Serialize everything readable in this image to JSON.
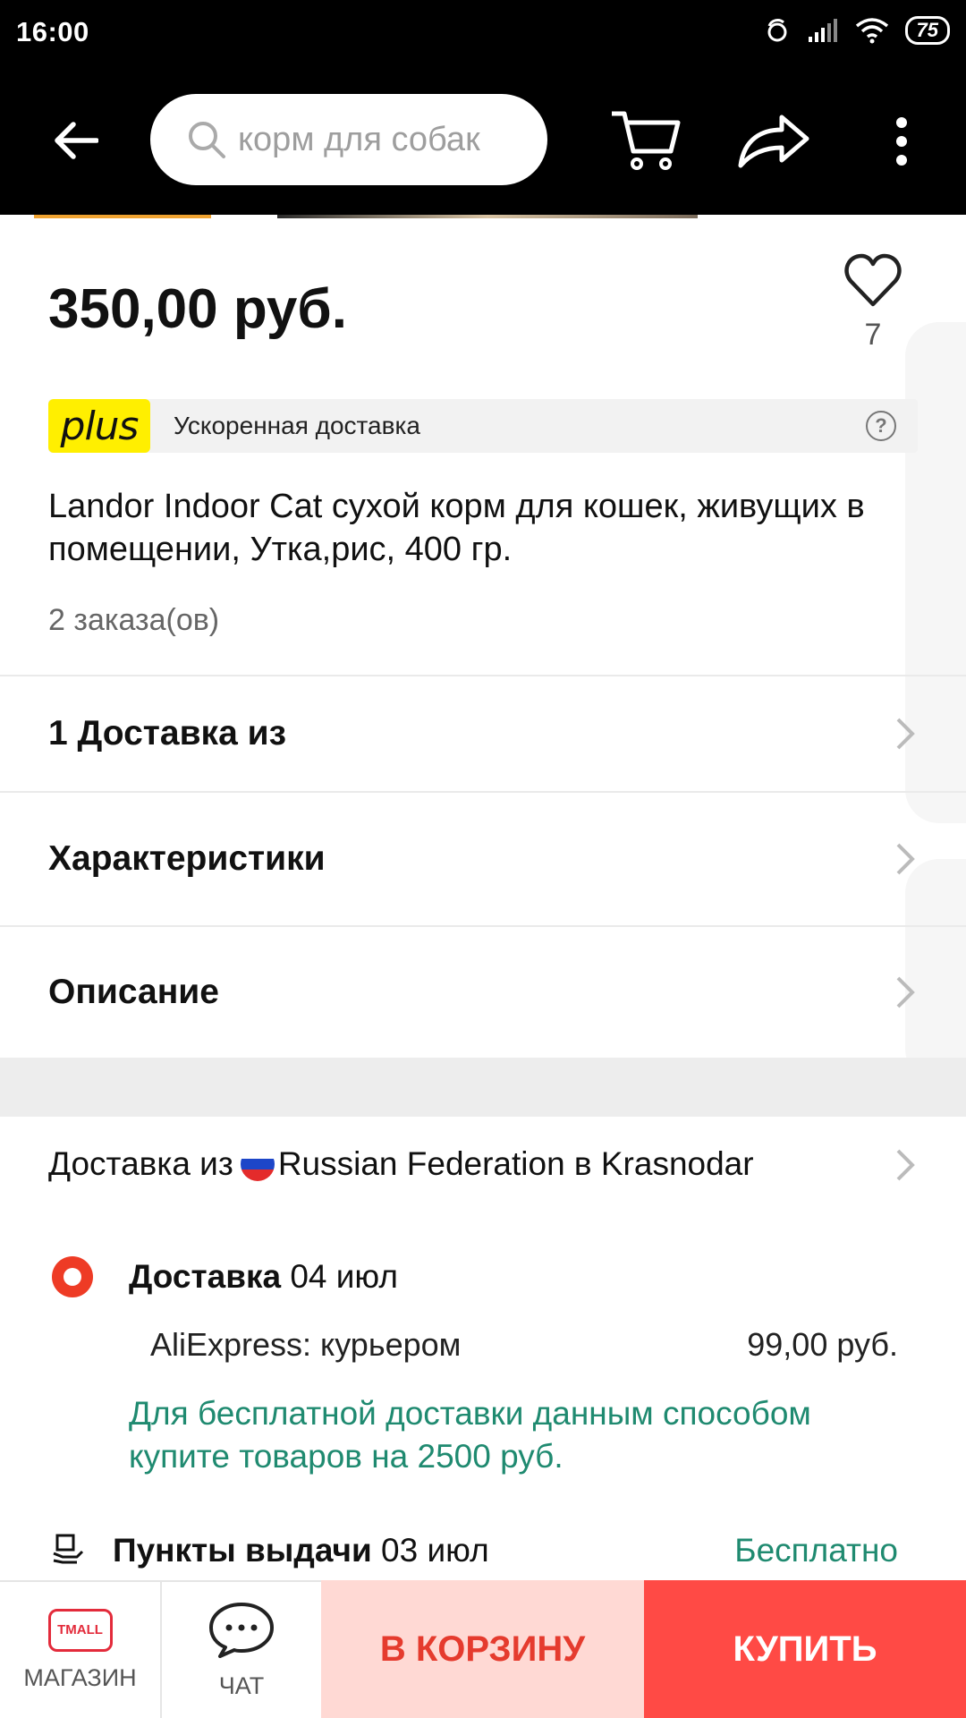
{
  "status_bar": {
    "time": "16:00",
    "battery": "75"
  },
  "header": {
    "search_placeholder": "корм для собак"
  },
  "product": {
    "price": "350,00 руб.",
    "wishlist_count": "7",
    "plus_logo": "plus",
    "plus_text": "Ускоренная доставка",
    "title": "Landor Indoor Cat сухой корм для кошек, живущих в помещении, Утка,рис, 400 гр.",
    "orders": "2 заказа(ов)"
  },
  "sections": {
    "delivery_from": "1 Доставка из",
    "specs": "Характеристики",
    "description": "Описание"
  },
  "shipping": {
    "from_prefix": "Доставка из",
    "from_country": "Russian Federation в Krasnodar",
    "option_label": "Доставка",
    "option_date": "04 июл",
    "carrier": "AliExpress: курьером",
    "carrier_price": "99,00 руб.",
    "free_note": "Для бесплатной доставки данным способом купите товаров на 2500 руб.",
    "pickup_label": "Пункты выдачи",
    "pickup_date": "03 июл",
    "pickup_price": "Бесплатно"
  },
  "bottom_bar": {
    "store_logo": "TMALL",
    "store_label": "МАГАЗИН",
    "chat_label": "ЧАТ",
    "add_to_cart": "В КОРЗИНУ",
    "buy": "КУПИТЬ"
  },
  "colors": {
    "accent_red": "#ff4a45",
    "cart_pink": "#ffd9d4",
    "green_text": "#1f8a70",
    "plus_yellow": "#ffef00"
  }
}
